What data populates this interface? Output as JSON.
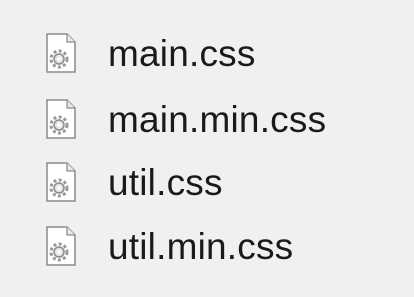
{
  "files": [
    {
      "name": "main.css",
      "icon": "css-file-gear-icon"
    },
    {
      "name": "main.min.css",
      "icon": "css-file-gear-icon"
    },
    {
      "name": "util.css",
      "icon": "css-file-gear-icon"
    },
    {
      "name": "util.min.css",
      "icon": "css-file-gear-icon"
    }
  ],
  "colors": {
    "background": "#f0f0f0",
    "text": "#1a1a1a",
    "icon_page": "#ffffff",
    "icon_outline": "#8a8a8a",
    "icon_gear": "#9a9a9a"
  }
}
